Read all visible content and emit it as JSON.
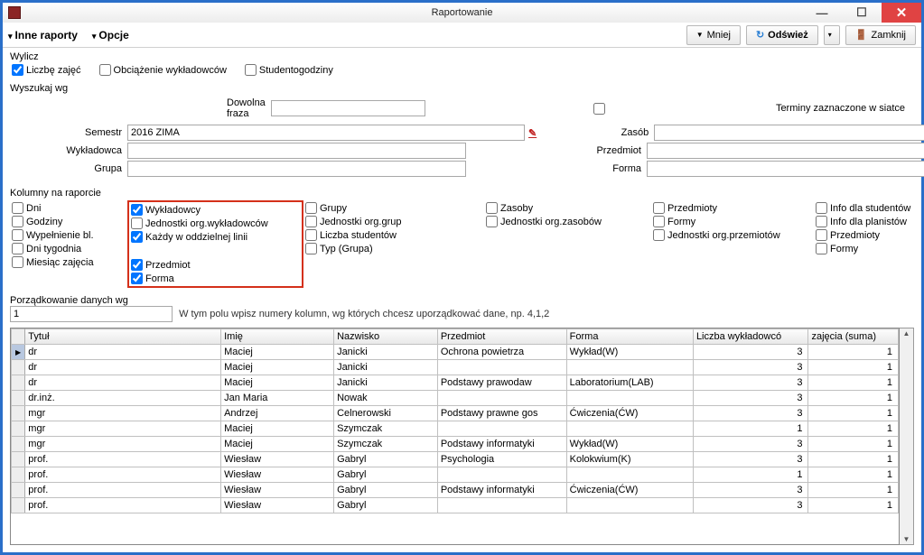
{
  "window": {
    "title": "Raportowanie"
  },
  "menus": {
    "inne": "Inne raporty",
    "opcje": "Opcje"
  },
  "buttons": {
    "mniej": "Mniej",
    "odswiez": "Odśwież",
    "zamknij": "Zamknij"
  },
  "wylicz": {
    "label": "Wylicz",
    "liczbe_zajec": "Liczbę zajęć",
    "obciazenie": "Obciążenie wykładowców",
    "studentogodziny": "Studentogodziny"
  },
  "wyszukaj": {
    "label": "Wyszukaj wg",
    "dowolna_label": "Dowolna fraza",
    "dowolna_val": "",
    "terminy": "Terminy zaznaczone w siatce",
    "semestr_label": "Semestr",
    "semestr_val": "2016 ZIMA",
    "zasob_label": "Zasób",
    "zasob_val": "",
    "wykladowca_label": "Wykładowca",
    "wykladowca_val": "",
    "przedmiot_label": "Przedmiot",
    "przedmiot_val": "",
    "grupa_label": "Grupa",
    "grupa_val": "",
    "forma_label": "Forma",
    "forma_val": ""
  },
  "kolumny": {
    "label": "Kolumny na raporcie",
    "col1": {
      "dni": "Dni",
      "godziny": "Godziny",
      "wypelnienie": "Wypełnienie bl.",
      "dni_tyg": "Dni tygodnia",
      "miesiac": "Miesiąc zajęcia"
    },
    "col2": {
      "wykladowcy": "Wykładowcy",
      "jednostki_wyk": "Jednostki org.wykładowców",
      "kazdy": "Każdy w oddzielnej linii",
      "przedmiot": "Przedmiot",
      "forma": "Forma"
    },
    "col3": {
      "grupy": "Grupy",
      "jednostki_grup": "Jednostki org.grup",
      "liczba_stud": "Liczba studentów",
      "typ_grupa": "Typ (Grupa)"
    },
    "col4": {
      "zasoby": "Zasoby",
      "jednostki_zas": "Jednostki org.zasobów"
    },
    "col5": {
      "przedmioty": "Przedmioty",
      "formy": "Formy",
      "jednostki_prz": "Jednostki org.przemiotów"
    },
    "col6": {
      "info_stud": "Info dla studentów",
      "info_plan": "Info dla planistów",
      "przedmioty": "Przedmioty",
      "formy": "Formy"
    }
  },
  "sort": {
    "label": "Porządkowanie danych wg",
    "value": "1",
    "hint": "W tym polu wpisz numery kolumn, wg których chcesz uporządkować dane, np. 4,1,2"
  },
  "table": {
    "headers": [
      "Tytuł",
      "Imię",
      "Nazwisko",
      "Przedmiot",
      "Forma",
      "Liczba wykładowcó",
      "zajęcia (suma)"
    ],
    "rows": [
      {
        "t": "dr",
        "i": "Maciej",
        "n": "Janicki",
        "p": "Ochrona powietrza",
        "f": "Wykład(W)",
        "lw": "3",
        "z": "1",
        "sel": true
      },
      {
        "t": "dr",
        "i": "Maciej",
        "n": "Janicki",
        "p": "",
        "f": "",
        "lw": "3",
        "z": "1"
      },
      {
        "t": "dr",
        "i": "Maciej",
        "n": "Janicki",
        "p": "Podstawy prawodaw",
        "f": "Laboratorium(LAB)",
        "lw": "3",
        "z": "1"
      },
      {
        "t": "dr.inż.",
        "i": "Jan Maria",
        "n": "Nowak",
        "p": "",
        "f": "",
        "lw": "3",
        "z": "1"
      },
      {
        "t": "mgr",
        "i": "Andrzej",
        "n": "Celnerowski",
        "p": "Podstawy prawne gos",
        "f": "Ćwiczenia(ĆW)",
        "lw": "3",
        "z": "1"
      },
      {
        "t": "mgr",
        "i": "Maciej",
        "n": "Szymczak",
        "p": "",
        "f": "",
        "lw": "1",
        "z": "1"
      },
      {
        "t": "mgr",
        "i": "Maciej",
        "n": "Szymczak",
        "p": "Podstawy informatyki",
        "f": "Wykład(W)",
        "lw": "3",
        "z": "1"
      },
      {
        "t": "prof.",
        "i": "Wiesław",
        "n": "Gabryl",
        "p": "Psychologia",
        "f": "Kolokwium(K)",
        "lw": "3",
        "z": "1"
      },
      {
        "t": "prof.",
        "i": "Wiesław",
        "n": "Gabryl",
        "p": "",
        "f": "",
        "lw": "1",
        "z": "1"
      },
      {
        "t": "prof.",
        "i": "Wiesław",
        "n": "Gabryl",
        "p": "Podstawy informatyki",
        "f": "Ćwiczenia(ĆW)",
        "lw": "3",
        "z": "1"
      },
      {
        "t": "prof.",
        "i": "Wiesław",
        "n": "Gabryl",
        "p": "",
        "f": "",
        "lw": "3",
        "z": "1"
      }
    ]
  }
}
